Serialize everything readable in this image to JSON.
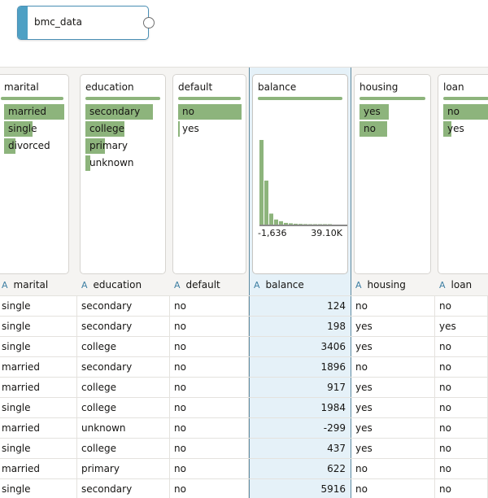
{
  "node": {
    "label": "bmc_data"
  },
  "columns": [
    {
      "key": "marital",
      "title": "marital",
      "type": "A",
      "header": "marital",
      "categories": [
        {
          "label": "married",
          "value": 0.92
        },
        {
          "label": "single",
          "value": 0.44
        },
        {
          "label": "divorced",
          "value": 0.18
        }
      ]
    },
    {
      "key": "education",
      "title": "education",
      "type": "A",
      "header": "education",
      "categories": [
        {
          "label": "secondary",
          "value": 0.92
        },
        {
          "label": "college",
          "value": 0.53
        },
        {
          "label": "primary",
          "value": 0.27
        },
        {
          "label": "unknown",
          "value": 0.07
        }
      ]
    },
    {
      "key": "default",
      "title": "default",
      "type": "A",
      "header": "default",
      "categories": [
        {
          "label": "no",
          "value": 1.0
        },
        {
          "label": "yes",
          "value": 0.03
        }
      ]
    },
    {
      "key": "balance",
      "title": "balance",
      "type": "A",
      "header": "balance",
      "histogram": {
        "min_label": "-1,636",
        "max_label": "39.10K",
        "bins": [
          1.0,
          0.52,
          0.13,
          0.06,
          0.04,
          0.02,
          0.015,
          0.01,
          0.008,
          0.006,
          0.004,
          0.003,
          0.002,
          0.002,
          0.001
        ]
      }
    },
    {
      "key": "housing",
      "title": "housing",
      "type": "A",
      "header": "housing",
      "categories": [
        {
          "label": "yes",
          "value": 0.45
        },
        {
          "label": "no",
          "value": 0.42
        }
      ]
    },
    {
      "key": "loan",
      "title": "loan",
      "type": "A",
      "header": "loan",
      "categories": [
        {
          "label": "no",
          "value": 1.0
        },
        {
          "label": "yes",
          "value": 0.18
        }
      ]
    }
  ],
  "rows": [
    [
      "single",
      "secondary",
      "no",
      "124",
      "no",
      "no"
    ],
    [
      "single",
      "secondary",
      "no",
      "198",
      "yes",
      "yes"
    ],
    [
      "single",
      "college",
      "no",
      "3406",
      "yes",
      "no"
    ],
    [
      "married",
      "secondary",
      "no",
      "1896",
      "no",
      "no"
    ],
    [
      "married",
      "college",
      "no",
      "917",
      "yes",
      "no"
    ],
    [
      "single",
      "college",
      "no",
      "1984",
      "yes",
      "no"
    ],
    [
      "married",
      "unknown",
      "no",
      "-299",
      "yes",
      "no"
    ],
    [
      "single",
      "college",
      "no",
      "437",
      "yes",
      "no"
    ],
    [
      "married",
      "primary",
      "no",
      "622",
      "no",
      "no"
    ],
    [
      "single",
      "secondary",
      "no",
      "5916",
      "no",
      "no"
    ]
  ],
  "colors": {
    "bar": "#8db47c",
    "accent": "#4ea0c4",
    "selected": "#e5f1f8"
  }
}
